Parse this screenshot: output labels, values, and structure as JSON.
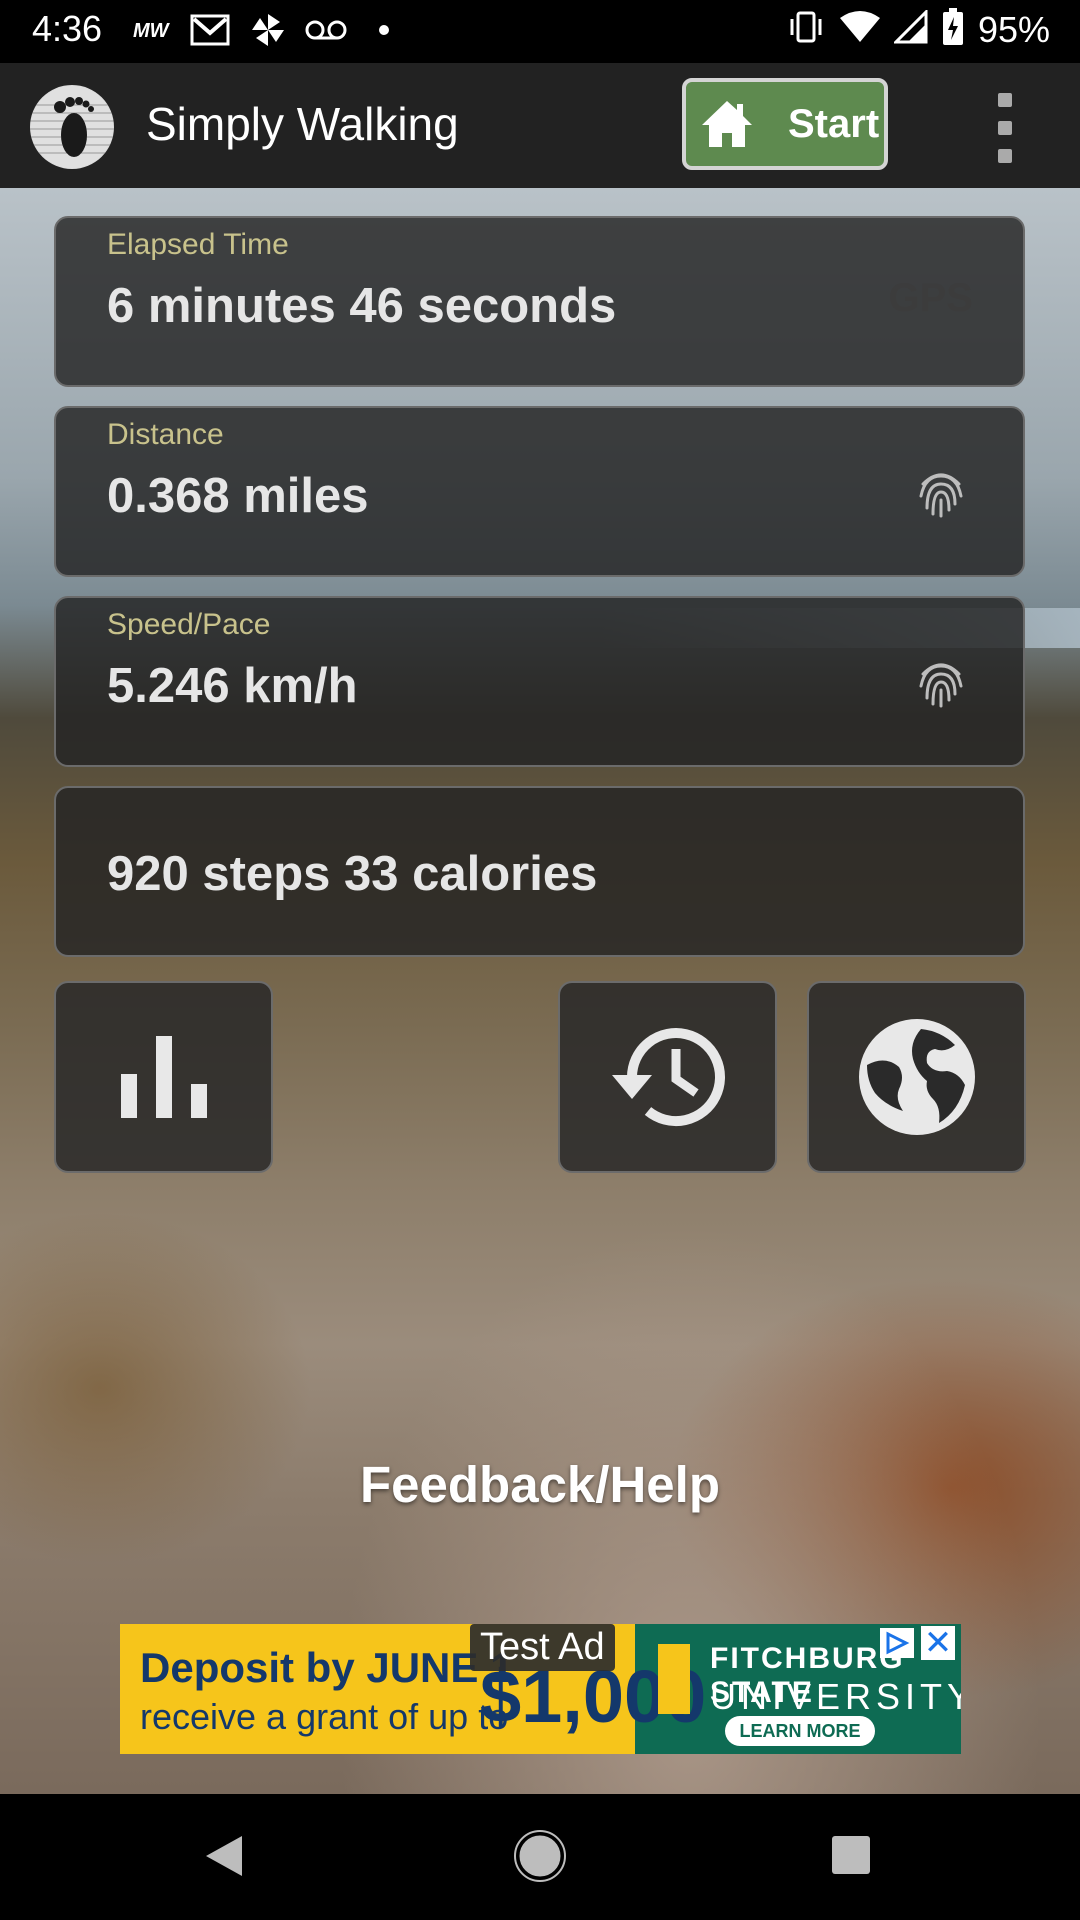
{
  "status_bar": {
    "time": "4:36",
    "battery": "95%",
    "icons": [
      "mw-icon",
      "gmail-icon",
      "pinwheel-icon",
      "voicemail-icon",
      "dot-icon",
      "vibrate-icon",
      "wifi-icon",
      "signal-icon",
      "battery-icon"
    ]
  },
  "app_bar": {
    "title": "Simply Walking",
    "start_label": "Start"
  },
  "cards": {
    "elapsed": {
      "label": "Elapsed Time",
      "value": "6 minutes 46 seconds",
      "badge": "GPS"
    },
    "distance": {
      "label": "Distance",
      "value": "0.368 miles"
    },
    "speed": {
      "label": "Speed/Pace",
      "value": "5.246 km/h"
    },
    "steps": {
      "value": "920 steps  33 calories"
    }
  },
  "tiles": [
    "bar-chart-icon",
    "history-icon",
    "globe-icon"
  ],
  "feedback": "Feedback/Help",
  "ad": {
    "line1": "Deposit by JUNE 1",
    "line2": "receive a grant of up to",
    "amount": "$1,000",
    "test_label": "Test Ad",
    "university_line1": "FITCHBURG STATE",
    "university_line2": "UNIVERSITY",
    "cta": "LEARN MORE",
    "close": "✕"
  },
  "colors": {
    "accent_green": "#5e8a4f",
    "label_gold": "#c8c28c",
    "ad_yellow": "#f6c51b",
    "ad_green": "#0e6b53"
  }
}
